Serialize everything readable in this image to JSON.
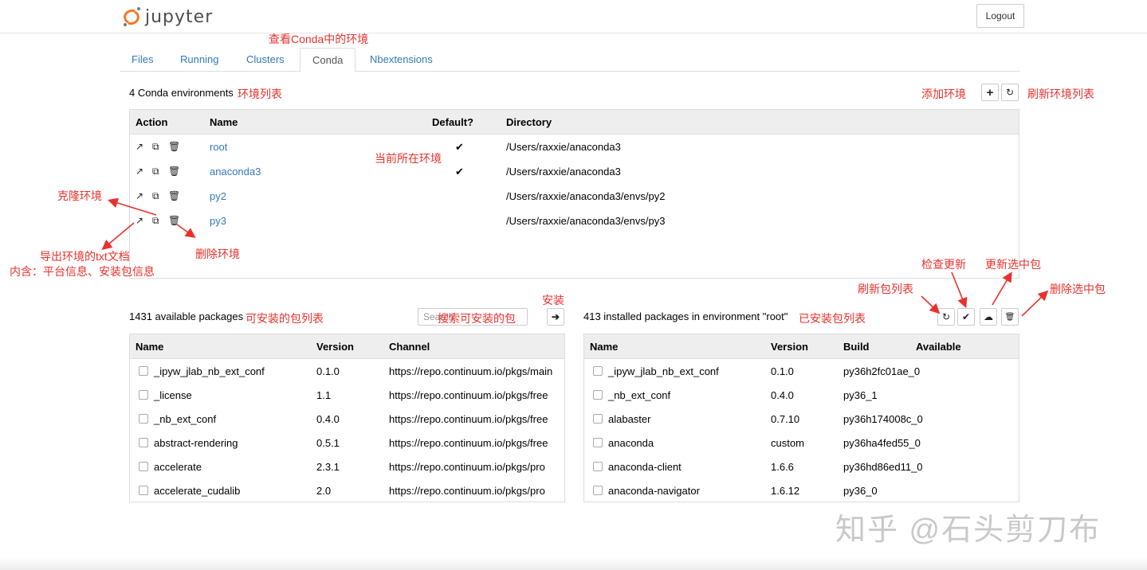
{
  "header": {
    "logo_text": "jupyter",
    "logout_label": "Logout"
  },
  "tabs": [
    {
      "label": "Files"
    },
    {
      "label": "Running"
    },
    {
      "label": "Clusters"
    },
    {
      "label": "Conda"
    },
    {
      "label": "Nbextensions"
    }
  ],
  "environments": {
    "count_label": "4 Conda environments",
    "columns": {
      "action": "Action",
      "name": "Name",
      "default": "Default?",
      "directory": "Directory"
    },
    "rows": [
      {
        "name": "root",
        "default": "✔",
        "directory": "/Users/raxxie/anaconda3"
      },
      {
        "name": "anaconda3",
        "default": "✔",
        "directory": "/Users/raxxie/anaconda3"
      },
      {
        "name": "py2",
        "default": "",
        "directory": "/Users/raxxie/anaconda3/envs/py2"
      },
      {
        "name": "py3",
        "default": "",
        "directory": "/Users/raxxie/anaconda3/envs/py3"
      }
    ],
    "add_icon": "plus-icon",
    "refresh_icon": "refresh-icon"
  },
  "available": {
    "count_label": "1431 available packages",
    "search_placeholder": "Search",
    "columns": {
      "name": "Name",
      "version": "Version",
      "channel": "Channel"
    },
    "rows": [
      {
        "name": "_ipyw_jlab_nb_ext_conf",
        "version": "0.1.0",
        "channel": "https://repo.continuum.io/pkgs/main"
      },
      {
        "name": "_license",
        "version": "1.1",
        "channel": "https://repo.continuum.io/pkgs/free"
      },
      {
        "name": "_nb_ext_conf",
        "version": "0.4.0",
        "channel": "https://repo.continuum.io/pkgs/free"
      },
      {
        "name": "abstract-rendering",
        "version": "0.5.1",
        "channel": "https://repo.continuum.io/pkgs/free"
      },
      {
        "name": "accelerate",
        "version": "2.3.1",
        "channel": "https://repo.continuum.io/pkgs/pro"
      },
      {
        "name": "accelerate_cudalib",
        "version": "2.0",
        "channel": "https://repo.continuum.io/pkgs/pro"
      }
    ]
  },
  "installed": {
    "count_label": "413 installed packages in environment \"root\"",
    "columns": {
      "name": "Name",
      "version": "Version",
      "build": "Build",
      "available": "Available"
    },
    "rows": [
      {
        "name": "_ipyw_jlab_nb_ext_conf",
        "version": "0.1.0",
        "build": "py36h2fc01ae_0"
      },
      {
        "name": "_nb_ext_conf",
        "version": "0.4.0",
        "build": "py36_1"
      },
      {
        "name": "alabaster",
        "version": "0.7.10",
        "build": "py36h174008c_0"
      },
      {
        "name": "anaconda",
        "version": "custom",
        "build": "py36ha4fed55_0"
      },
      {
        "name": "anaconda-client",
        "version": "1.6.6",
        "build": "py36hd86ed11_0"
      },
      {
        "name": "anaconda-navigator",
        "version": "1.6.12",
        "build": "py36_0"
      }
    ]
  },
  "annotations": {
    "view_conda": "查看Conda中的环境",
    "env_list": "环境列表",
    "add_env": "添加环境",
    "refresh_env": "刷新环境列表",
    "current_env": "当前所在环境",
    "clone_env": "克隆环境",
    "export_env": "导出环境的txt文档",
    "export_detail": "内含：平台信息、安装包信息",
    "delete_env": "删除环境",
    "check_update": "检查更新",
    "update_selected": "更新选中包",
    "refresh_pkgs": "刷新包列表",
    "delete_selected": "删除选中包",
    "install": "安装",
    "search_install": "搜索可安装的包",
    "available_list": "可安装的包列表",
    "installed_list": "已安装包列表"
  },
  "watermark": "知乎 @石头剪刀布",
  "colors": {
    "annotation": "#e8312d",
    "link": "#337ab7",
    "logo": "#f37726",
    "header_bg": "#eeeeee"
  }
}
